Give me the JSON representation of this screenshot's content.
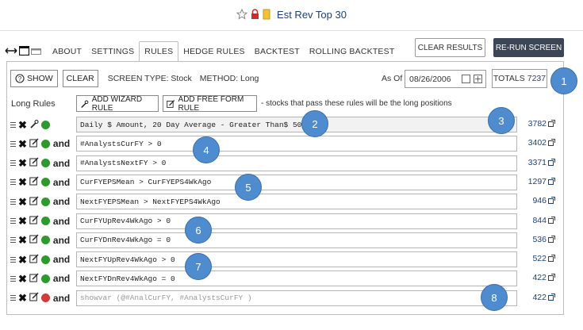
{
  "title": {
    "text": "Est Rev Top 30"
  },
  "tabs": [
    {
      "label": "ABOUT"
    },
    {
      "label": "SETTINGS"
    },
    {
      "label": "RULES"
    },
    {
      "label": "HEDGE RULES"
    },
    {
      "label": "BACKTEST"
    },
    {
      "label": "ROLLING BACKTEST"
    }
  ],
  "actions": {
    "clear_results": "CLEAR RESULTS",
    "rerun": "RE-RUN SCREEN"
  },
  "toolbar": {
    "show": "SHOW",
    "clear": "CLEAR",
    "screen_type": "SCREEN TYPE: Stock",
    "method": "METHOD: Long",
    "as_of_label": "As Of",
    "as_of_date": "08/26/2006",
    "totals_label": "TOTALS",
    "totals_value": "7237"
  },
  "long_rules": {
    "label": "Long Rules",
    "add_wizard": "ADD WIZARD RULE",
    "add_free_form": "ADD FREE FORM RULE",
    "note": "- stocks that pass these rules will be the long positions"
  },
  "colors": {
    "accent": "#1f3f7a",
    "dot_green": "#2e9a2e",
    "dot_red": "#d23b3b",
    "callout": "#4e8ccf",
    "rerun_bg": "#3d4656"
  },
  "rules": [
    {
      "text": "Daily $ Amount, 20 Day Average - Greater Than$ 500K",
      "count": "3782",
      "and": "",
      "status": "green",
      "kind": "wizard"
    },
    {
      "text": "#AnalystsCurFY > 0",
      "count": "3402",
      "and": "and",
      "status": "green",
      "kind": "free"
    },
    {
      "text": "#AnalystsNextFY > 0",
      "count": "3371",
      "and": "and",
      "status": "green",
      "kind": "free"
    },
    {
      "text": "CurFYEPSMean >  CurFYEPS4WkAgo",
      "count": "1297",
      "and": "and",
      "status": "green",
      "kind": "free"
    },
    {
      "text": "NextFYEPSMean >  NextFYEPS4WkAgo",
      "count": "946",
      "and": "and",
      "status": "green",
      "kind": "free"
    },
    {
      "text": "CurFYUpRev4WkAgo > 0",
      "count": "844",
      "and": "and",
      "status": "green",
      "kind": "free"
    },
    {
      "text": "CurFYDnRev4WkAgo = 0",
      "count": "536",
      "and": "and",
      "status": "green",
      "kind": "free"
    },
    {
      "text": "NextFYUpRev4WkAgo > 0",
      "count": "522",
      "and": "and",
      "status": "green",
      "kind": "free"
    },
    {
      "text": "NextFYDnRev4WkAgo = 0",
      "count": "422",
      "and": "and",
      "status": "green",
      "kind": "free"
    },
    {
      "text": "showvar (@#AnalCurFY, #AnalystsCurFY )",
      "count": "422",
      "and": "and",
      "status": "red",
      "kind": "free"
    }
  ],
  "callouts": [
    "1",
    "2",
    "3",
    "4",
    "5",
    "6",
    "7",
    "8"
  ]
}
